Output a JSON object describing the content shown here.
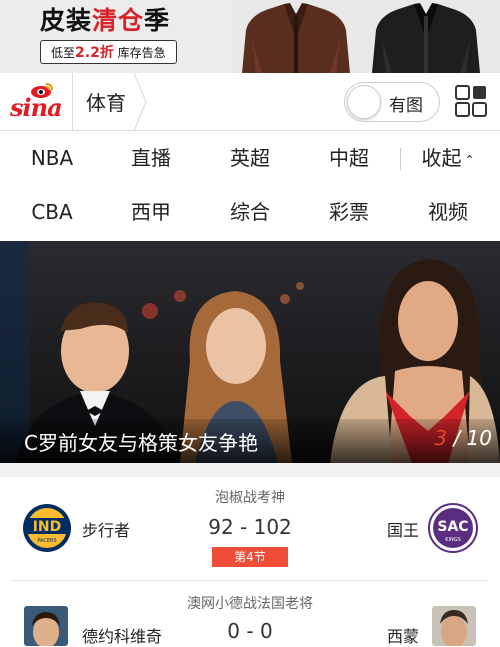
{
  "ad": {
    "title_plain": "皮装",
    "title_red": "清仓",
    "title_tail": "季",
    "sub_pre": "低至",
    "sub_discount": "2.2折",
    "sub_post": " 库存告急"
  },
  "header": {
    "logo": "sina",
    "section": "体育",
    "toggle_label": "有图"
  },
  "nav": {
    "row1": [
      "NBA",
      "直播",
      "英超",
      "中超"
    ],
    "collapse_label": "收起",
    "row2": [
      "CBA",
      "西甲",
      "综合",
      "彩票",
      "视频"
    ]
  },
  "hero": {
    "title": "C罗前女友与格策女友争艳",
    "current": "3",
    "separator": " / ",
    "total": "10"
  },
  "matches": [
    {
      "title": "泡椒战考神",
      "home": "步行者",
      "away": "国王",
      "score": "92 - 102",
      "status": "第4节",
      "home_logo": "IND",
      "home_logo_sub": "PACERS",
      "away_logo": "SAC",
      "away_logo_sub": "KINGS"
    },
    {
      "title": "澳网小德战法国老将",
      "home": "德约科维奇",
      "away": "西蒙",
      "score": "0 - 0"
    }
  ],
  "colors": {
    "accent_red": "#e41b23",
    "status_red": "#f04d38",
    "pacers_navy": "#002d62",
    "pacers_gold": "#fdbb30",
    "kings_purple": "#5a2d81"
  }
}
